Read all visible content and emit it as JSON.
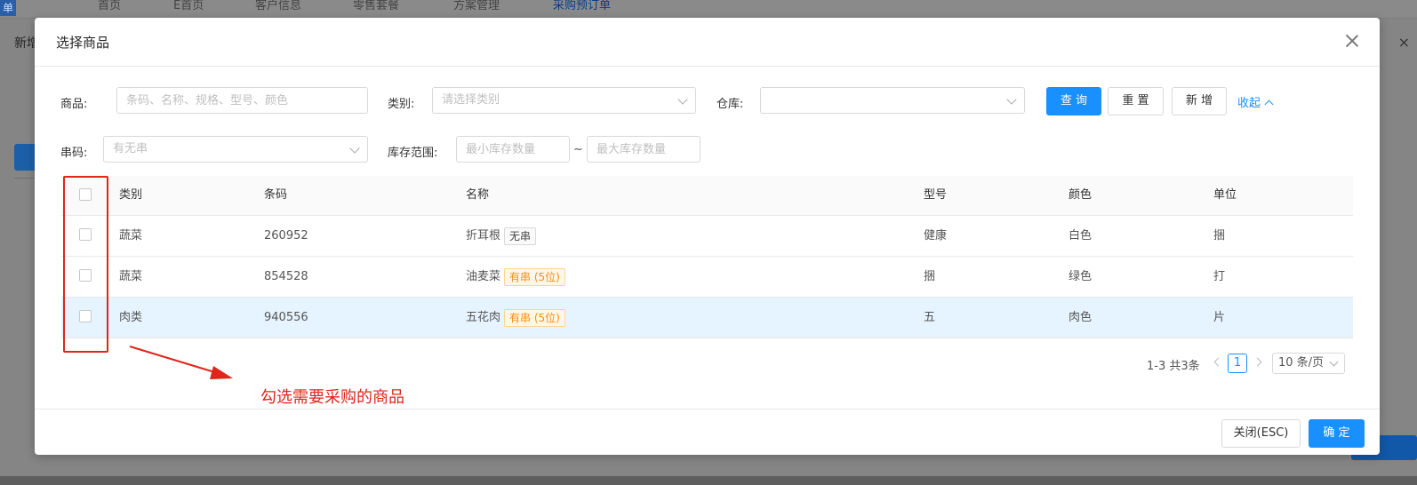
{
  "background": {
    "corner_label": "单",
    "nav_tabs": [
      "首页",
      "E首页",
      "客户信息",
      "零售套餐",
      "方案管理",
      "采购预订单"
    ],
    "page_title": "新增",
    "close_glyph": "×"
  },
  "modal": {
    "title": "选择商品",
    "filters": {
      "product_label": "商品:",
      "product_placeholder": "条码、名称、规格、型号、颜色",
      "category_label": "类别:",
      "category_placeholder": "请选择类别",
      "warehouse_label": "仓库:",
      "warehouse_value": "",
      "serial_label": "串码:",
      "serial_placeholder": "有无串",
      "stock_range_label": "库存范围:",
      "min_stock_placeholder": "最小库存数量",
      "range_sep": "~",
      "max_stock_placeholder": "最大库存数量"
    },
    "buttons": {
      "query": "查 询",
      "reset": "重 置",
      "add": "新 增",
      "collapse": "收起"
    },
    "table": {
      "columns": [
        "类别",
        "条码",
        "名称",
        "型号",
        "颜色",
        "单位"
      ],
      "rows": [
        {
          "category": "蔬菜",
          "barcode": "260952",
          "name": "折耳根",
          "tag": "无串",
          "model": "健康",
          "color": "白色",
          "unit": "捆"
        },
        {
          "category": "蔬菜",
          "barcode": "854528",
          "name": "油麦菜",
          "tag": "有串 (5位)",
          "model": "捆",
          "color": "绿色",
          "unit": "打"
        },
        {
          "category": "肉类",
          "barcode": "940556",
          "name": "五花肉",
          "tag": "有串 (5位)",
          "model": "五",
          "color": "肉色",
          "unit": "片"
        }
      ]
    },
    "pagination": {
      "total": "1-3 共3条",
      "current_page": "1",
      "page_size": "10 条/页"
    },
    "footer": {
      "close": "关闭(ESC)",
      "confirm": "确 定"
    }
  },
  "annotation": {
    "text": "勾选需要采购的商品",
    "color": "#e0251b"
  },
  "colors": {
    "primary": "#1890ff",
    "tag_orange": "#fa8c16",
    "row_highlight": "#e6f4ff"
  }
}
